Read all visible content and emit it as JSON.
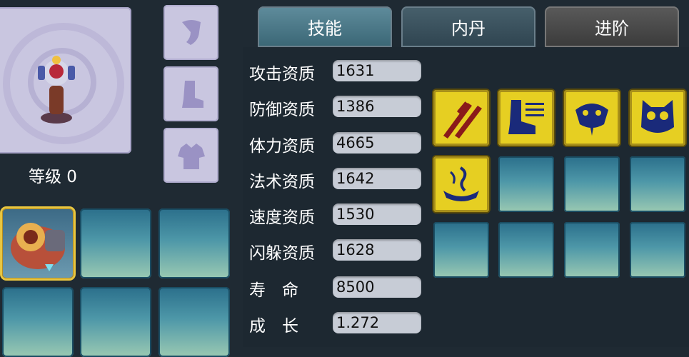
{
  "pet": {
    "level_label": "等级 0"
  },
  "tabs": [
    {
      "label": "技能",
      "state": "active"
    },
    {
      "label": "内丹",
      "state": "inactive"
    },
    {
      "label": "进阶",
      "state": "locked"
    }
  ],
  "stats": [
    {
      "label": "攻击资质",
      "value": "1631"
    },
    {
      "label": "防御资质",
      "value": "1386"
    },
    {
      "label": "体力资质",
      "value": "4665"
    },
    {
      "label": "法术资质",
      "value": "1642"
    },
    {
      "label": "速度资质",
      "value": "1530"
    },
    {
      "label": "闪躲资质",
      "value": "1628"
    },
    {
      "label": "寿　命",
      "value": "8500"
    },
    {
      "label": "成　长",
      "value": "1.272"
    }
  ],
  "equipment": [
    {
      "icon": "necklace-icon"
    },
    {
      "icon": "boots-icon"
    },
    {
      "icon": "armor-icon"
    }
  ],
  "skills": [
    {
      "icon": "swords-skill-icon"
    },
    {
      "icon": "speed-boot-skill-icon"
    },
    {
      "icon": "serpent-skill-icon"
    },
    {
      "icon": "owl-skill-icon"
    },
    {
      "icon": "dragon-boat-skill-icon"
    }
  ],
  "colors": {
    "background": "#1f2a33",
    "skill_gold": "#e6cf22",
    "skill_glyph": "#1a2a7a",
    "slot_teal": "#4d97a8"
  }
}
